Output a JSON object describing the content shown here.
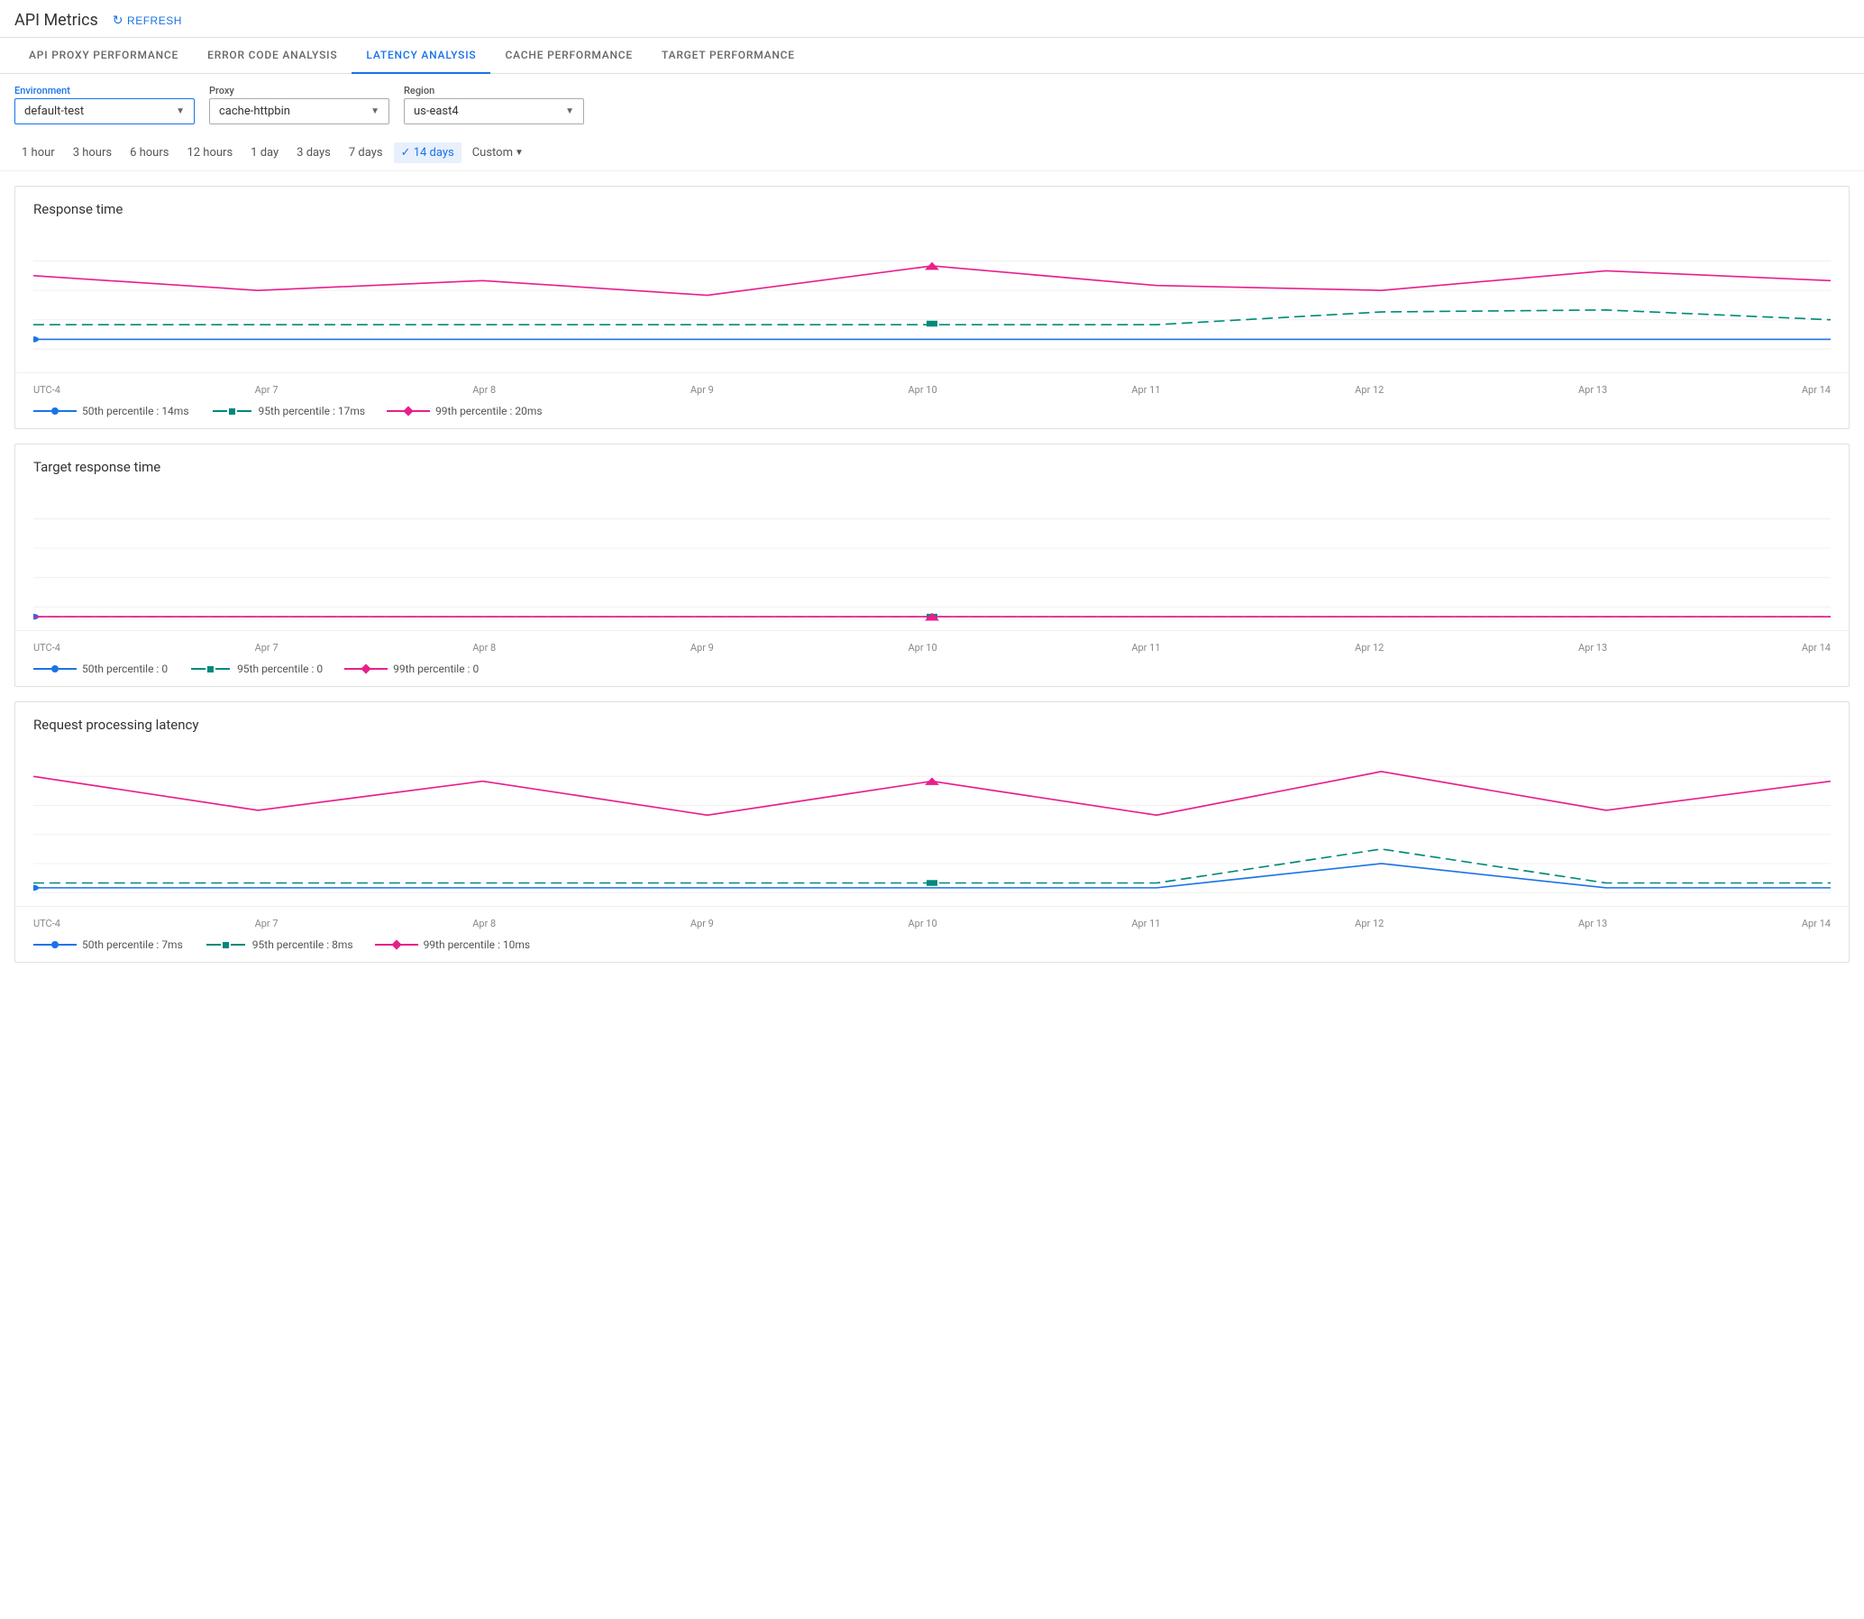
{
  "header": {
    "title": "API Metrics",
    "refresh_label": "REFRESH"
  },
  "tabs": [
    {
      "id": "api-proxy",
      "label": "API PROXY PERFORMANCE",
      "active": false
    },
    {
      "id": "error-code",
      "label": "ERROR CODE ANALYSIS",
      "active": false
    },
    {
      "id": "latency",
      "label": "LATENCY ANALYSIS",
      "active": true
    },
    {
      "id": "cache",
      "label": "CACHE PERFORMANCE",
      "active": false
    },
    {
      "id": "target",
      "label": "TARGET PERFORMANCE",
      "active": false
    }
  ],
  "filters": {
    "environment": {
      "label": "Environment",
      "value": "default-test"
    },
    "proxy": {
      "label": "Proxy",
      "value": "cache-httpbin"
    },
    "region": {
      "label": "Region",
      "value": "us-east4"
    }
  },
  "time_filters": {
    "options": [
      "1 hour",
      "3 hours",
      "6 hours",
      "12 hours",
      "1 day",
      "3 days",
      "7 days",
      "14 days",
      "Custom"
    ],
    "active": "14 days"
  },
  "charts": {
    "response_time": {
      "title": "Response time",
      "x_labels": [
        "UTC-4",
        "Apr 7",
        "Apr 8",
        "Apr 9",
        "Apr 10",
        "Apr 11",
        "Apr 12",
        "Apr 13",
        "Apr 14"
      ],
      "legend": [
        {
          "type": "blue",
          "label": "50th percentile : 14ms"
        },
        {
          "type": "teal",
          "label": "95th percentile : 17ms"
        },
        {
          "type": "pink",
          "label": "99th percentile : 20ms"
        }
      ]
    },
    "target_response_time": {
      "title": "Target response time",
      "x_labels": [
        "UTC-4",
        "Apr 7",
        "Apr 8",
        "Apr 9",
        "Apr 10",
        "Apr 11",
        "Apr 12",
        "Apr 13",
        "Apr 14"
      ],
      "legend": [
        {
          "type": "blue",
          "label": "50th percentile : 0"
        },
        {
          "type": "teal",
          "label": "95th percentile : 0"
        },
        {
          "type": "pink",
          "label": "99th percentile : 0"
        }
      ]
    },
    "request_processing": {
      "title": "Request processing latency",
      "x_labels": [
        "UTC-4",
        "Apr 7",
        "Apr 8",
        "Apr 9",
        "Apr 10",
        "Apr 11",
        "Apr 12",
        "Apr 13",
        "Apr 14"
      ],
      "legend": [
        {
          "type": "blue",
          "label": "50th percentile : 7ms"
        },
        {
          "type": "teal",
          "label": "95th percentile : 8ms"
        },
        {
          "type": "pink",
          "label": "99th percentile : 10ms"
        }
      ]
    }
  }
}
